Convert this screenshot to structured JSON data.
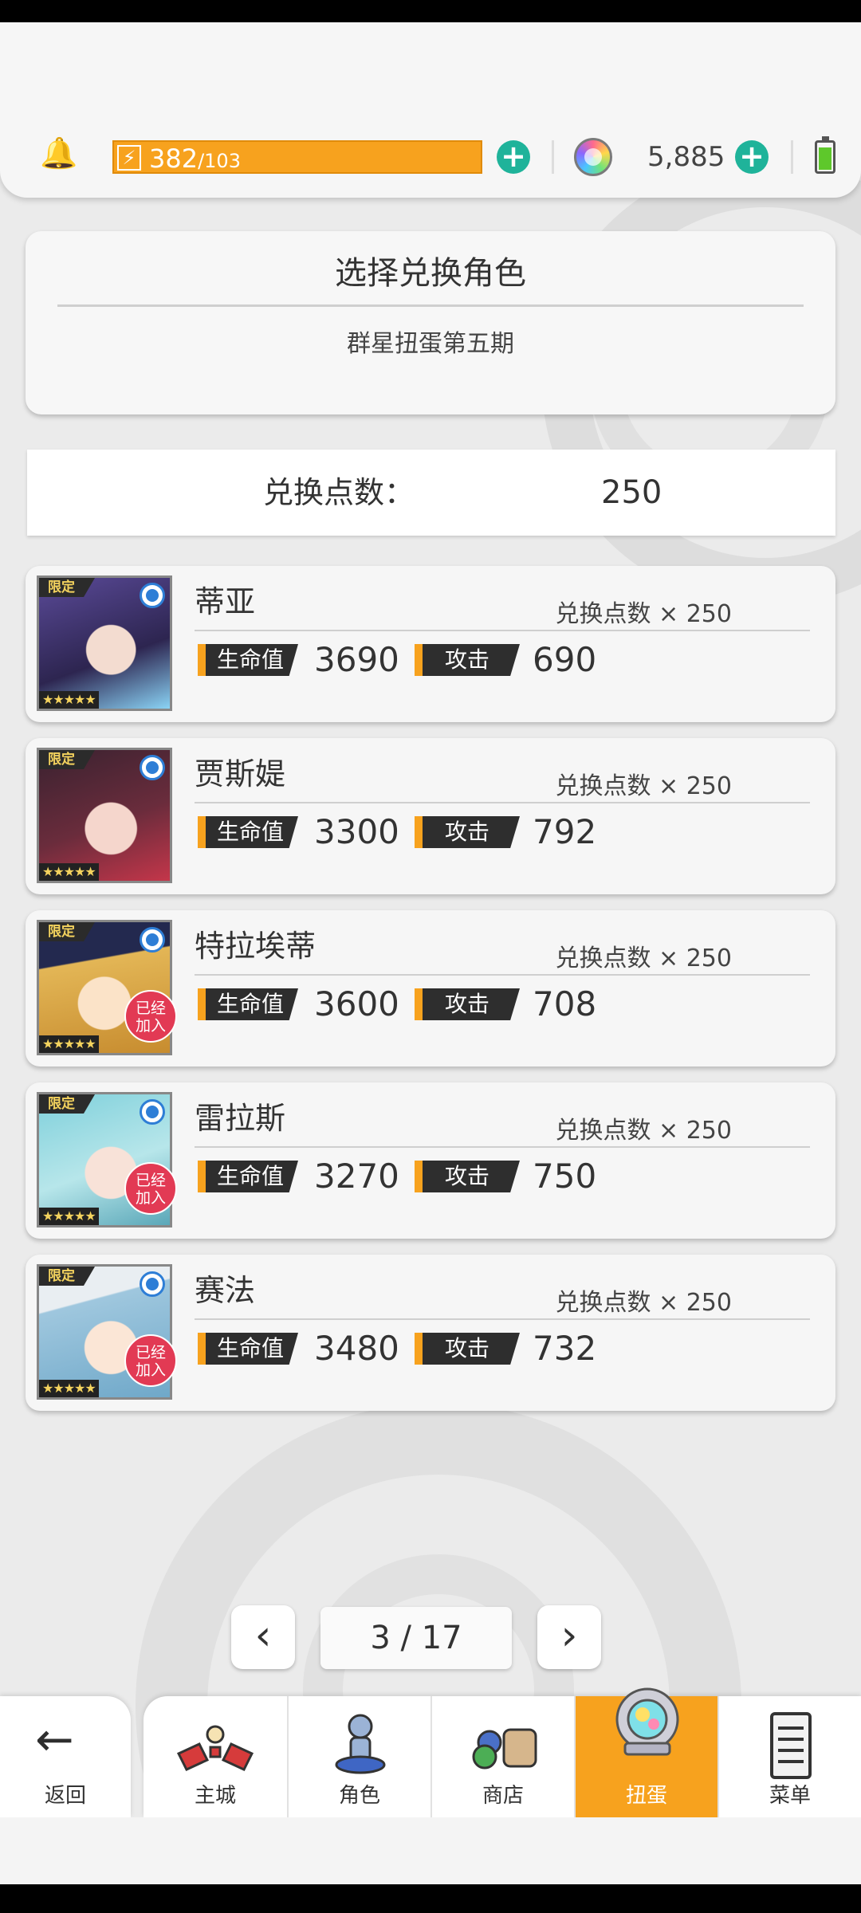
{
  "status": {
    "energy_current": "382",
    "energy_max": "/103",
    "gems": "5,885",
    "energy_icon": "bolt-icon",
    "gem_icon": "rainbow-gem-icon",
    "bell_icon": "bell-icon",
    "battery_icon": "battery-icon",
    "accent": "#f7a21e",
    "plus_color": "#1fb39a"
  },
  "header": {
    "title": "选择兑换角色",
    "subtitle": "群星扭蛋第五期"
  },
  "points": {
    "label": "兑换点数：",
    "value": "250"
  },
  "labels": {
    "limited": "限定",
    "stars": "★★★★★",
    "joined": "已经加入",
    "hp": "生命值",
    "atk": "攻击"
  },
  "characters": [
    {
      "name": "蒂亚",
      "cost": "兑换点数 × 250",
      "hp": "3690",
      "atk": "690",
      "joined": false
    },
    {
      "name": "贾斯媞",
      "cost": "兑换点数 × 250",
      "hp": "3300",
      "atk": "792",
      "joined": false
    },
    {
      "name": "特拉埃蒂",
      "cost": "兑换点数 × 250",
      "hp": "3600",
      "atk": "708",
      "joined": true
    },
    {
      "name": "雷拉斯",
      "cost": "兑换点数 × 250",
      "hp": "3270",
      "atk": "750",
      "joined": true
    },
    {
      "name": "赛法",
      "cost": "兑换点数 × 250",
      "hp": "3480",
      "atk": "732",
      "joined": true
    }
  ],
  "pager": {
    "prev": "‹",
    "next": "›",
    "indicator": "3 / 17"
  },
  "nav": {
    "back": "返回",
    "items": [
      {
        "label": "主城",
        "icon": "castle-icon"
      },
      {
        "label": "角色",
        "icon": "character-statue-icon"
      },
      {
        "label": "商店",
        "icon": "shop-bags-icon"
      },
      {
        "label": "扭蛋",
        "icon": "gacha-orb-icon",
        "active": true
      },
      {
        "label": "菜单",
        "icon": "menu-list-icon"
      }
    ]
  }
}
